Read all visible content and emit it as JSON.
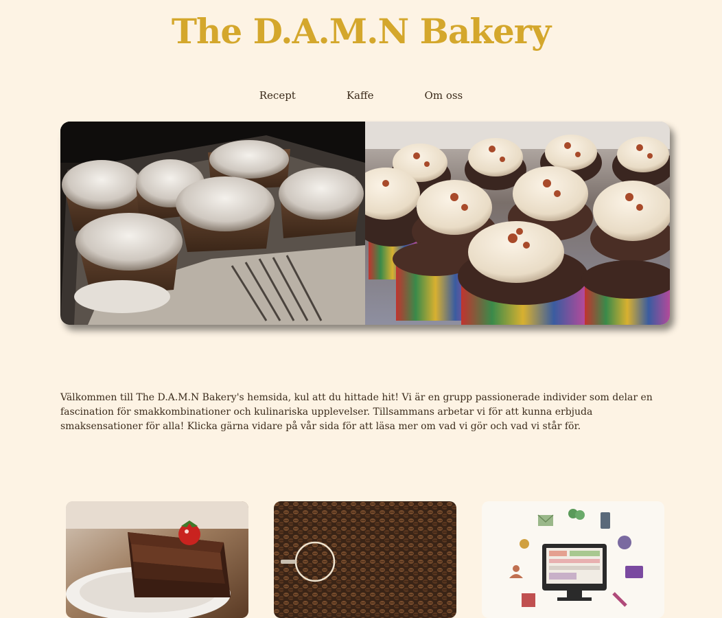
{
  "header": {
    "title": "The D.A.M.N Bakery"
  },
  "nav": {
    "items": [
      {
        "label": "Recept"
      },
      {
        "label": "Kaffe"
      },
      {
        "label": "Om oss"
      }
    ]
  },
  "hero": {
    "images": [
      {
        "icon": "powdered-muffins-photo"
      },
      {
        "icon": "frosted-cupcakes-photo"
      }
    ]
  },
  "intro": {
    "text": "Välkommen till The D.A.M.N Bakery's hemsida, kul att du hittade hit! Vi är en grupp passionerade individer som delar en fascination för smakkombinationer och kulinariska upplevelser. Tillsammans arbetar vi för att kunna erbjuda smaksensationer för alla! Klicka gärna vidare på vår sida för att läsa mer om vad vi gör och vad vi står för."
  },
  "cards": [
    {
      "icon": "chocolate-cake-photo"
    },
    {
      "icon": "coffee-beans-photo"
    },
    {
      "icon": "contact-illustration"
    }
  ],
  "colors": {
    "background": "#fdf3e4",
    "title": "#d4a72c",
    "text": "#3a2a1a"
  }
}
